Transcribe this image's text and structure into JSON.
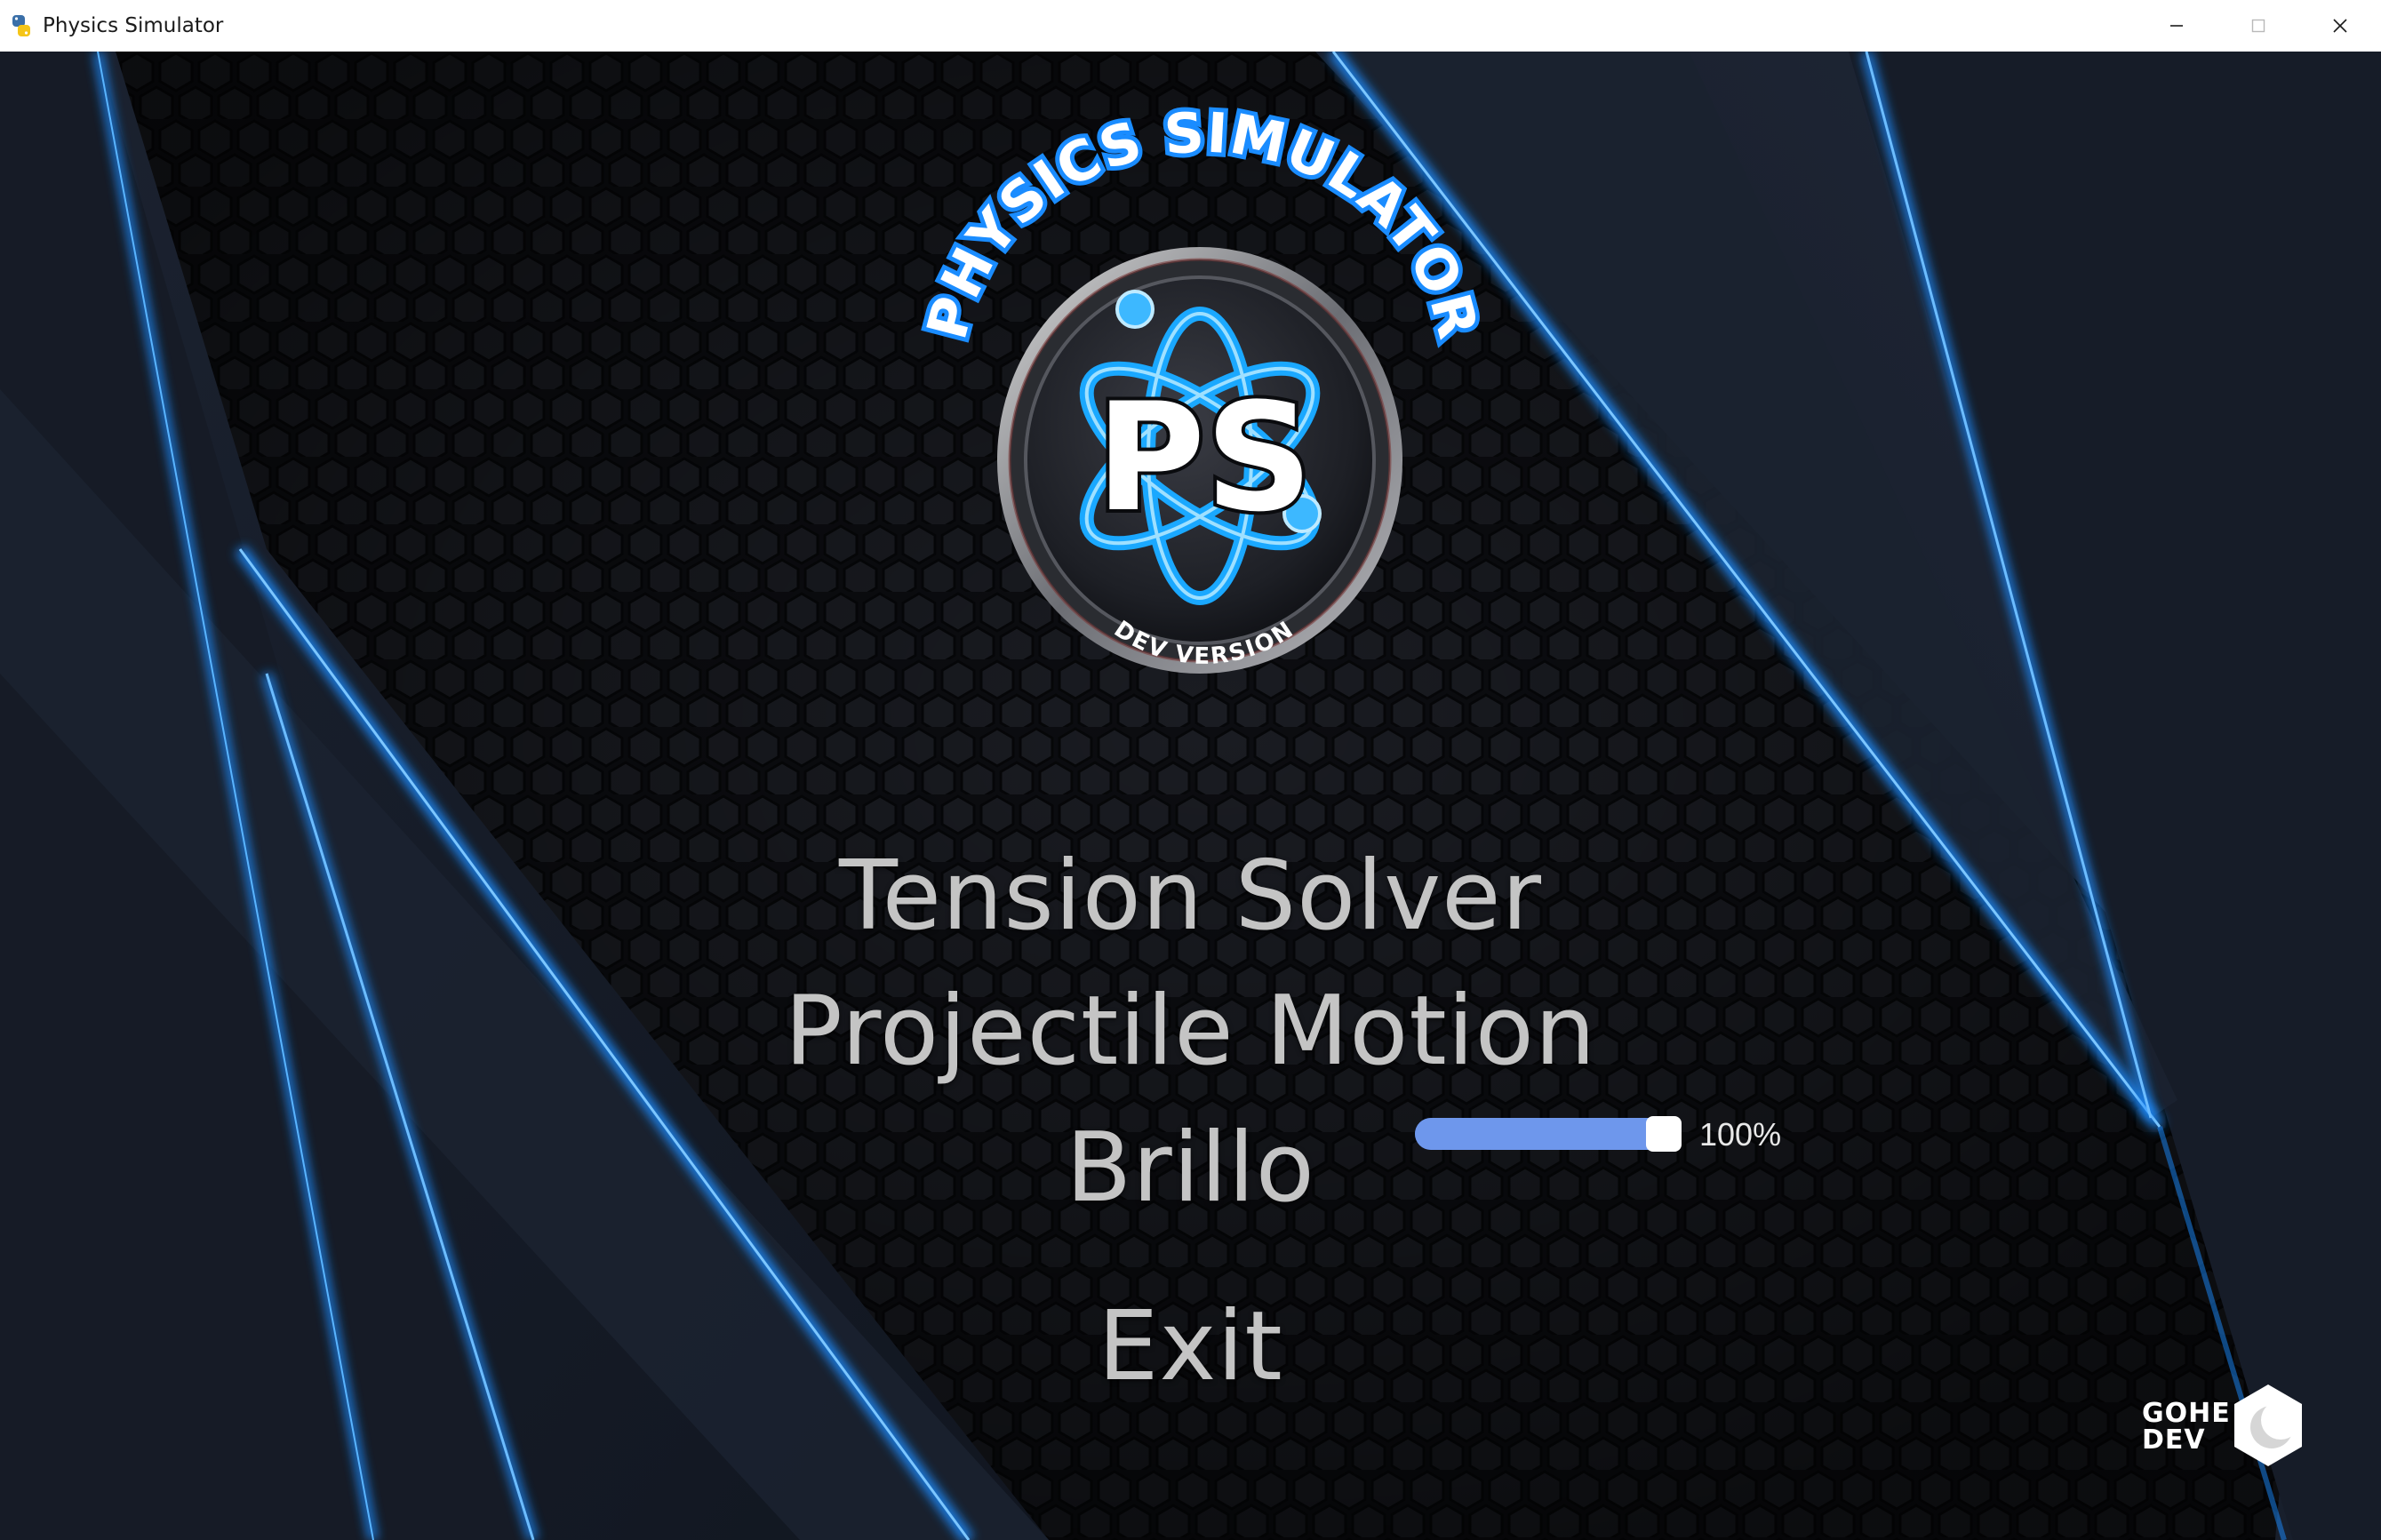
{
  "window": {
    "title": "Physics Simulator",
    "app_icon": "python-icon",
    "controls": [
      "minimize-icon",
      "maximize-icon",
      "close-icon"
    ]
  },
  "logo": {
    "icon": "physics-simulator-logo",
    "banner_text": "PHYSICS SIMULATOR",
    "monogram": "PS",
    "badge_text": "DEV VERSION"
  },
  "menu": {
    "items": [
      {
        "label": "Tension Solver"
      },
      {
        "label": "Projectile Motion"
      },
      {
        "label": "Brillo"
      },
      {
        "label": "Exit"
      }
    ]
  },
  "brightness": {
    "value": 1.0,
    "value_label": "100%"
  },
  "brand": {
    "line1": "GOHE",
    "line2": "DEV",
    "icon": "hexagon-moon-icon"
  },
  "colors": {
    "accent_blue": "#1a8cff",
    "menu_text": "#c4c4c4",
    "slider_fill": "#6e97ec",
    "slider_track": "#3c5ea8"
  }
}
